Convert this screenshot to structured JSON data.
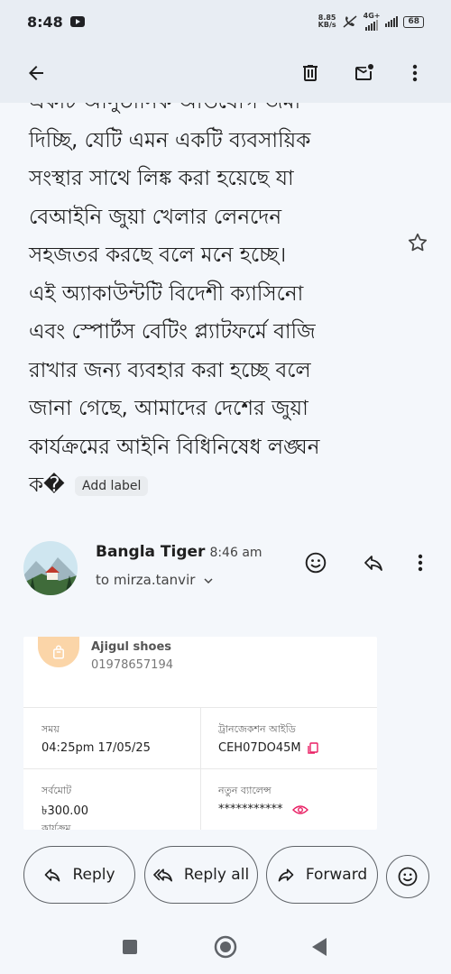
{
  "status": {
    "time": "8:48",
    "speed_value": "8.85",
    "speed_unit": "KB/s",
    "network": "4G+",
    "battery": "68"
  },
  "toolbar": {
    "back_icon": "arrow-left-icon",
    "delete_icon": "trash-icon",
    "unread_icon": "mark-unread-icon",
    "more_icon": "more-vert-icon"
  },
  "message": {
    "body_lines": [
      "একটি আনুষ্ঠানিক অভিযোগ জমা",
      "দিচ্ছি, যেটি এমন একটি ব্যবসায়িক",
      "সংস্থার সাথে লিঙ্ক করা হয়েছে যা",
      "বেআইনি জুয়া খেলার লেনদেন",
      "সহজতর করছে বলে মনে হচ্ছে।",
      "এই অ্যাকাউন্টটি বিদেশী ক্যাসিনো",
      "এবং স্পোর্টস বেটিং প্ল্যাটফর্মে বাজি",
      "রাখার জন্য ব্যবহার করা হচ্ছে বলে",
      "জানা গেছে, আমাদের দেশের জুয়া",
      "কার্যক্রমের আইনি বিধিনিষেধ লঙ্ঘন",
      "ক�"
    ],
    "add_label": "Add label"
  },
  "reply_message": {
    "sender_name": "Bangla Tiger",
    "time": "8:46 am",
    "to_line": "to mirza.tanvir"
  },
  "receipt": {
    "shop_name": "Ajigul shoes",
    "shop_phone": "01978657194",
    "time_label": "সময়",
    "time_value": "04:25pm 17/05/25",
    "txn_label": "ট্রানজেকশন আইডি",
    "txn_value": "CEH07DO45M",
    "total_label": "সর্বমোট",
    "total_value": "৳300.00",
    "balance_label": "নতুন ব্যালেন্স",
    "balance_value": "***********",
    "cutoff_label": "কার্যক্রম"
  },
  "actions": {
    "reply": "Reply",
    "reply_all": "Reply all",
    "forward": "Forward"
  },
  "colors": {
    "bar_bg": "#e8edf3",
    "page_bg": "#f4f7fb",
    "accent_pink": "#e91e63",
    "badge_orange": "#fbd5a8"
  }
}
